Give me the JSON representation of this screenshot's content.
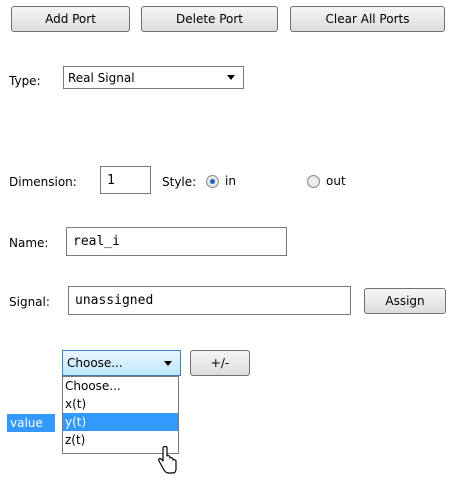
{
  "toolbar": {
    "add_port": "Add Port",
    "delete_port": "Delete Port",
    "clear_all_ports": "Clear All Ports"
  },
  "type": {
    "label": "Type:",
    "value": "Real Signal"
  },
  "dimension": {
    "label": "Dimension:",
    "value": "1"
  },
  "style": {
    "label": "Style:",
    "options": [
      "in",
      "out"
    ],
    "selected": "in"
  },
  "name": {
    "label": "Name:",
    "value": "real_i"
  },
  "signal": {
    "label": "Signal:",
    "value": "unassigned",
    "assign_label": "Assign"
  },
  "choose": {
    "value": "Choose...",
    "plus_minus_label": "+/-",
    "options": [
      "Choose...",
      "x(t)",
      "y(t)",
      "z(t)"
    ],
    "highlighted": "y(t)"
  },
  "value_tag": "value"
}
